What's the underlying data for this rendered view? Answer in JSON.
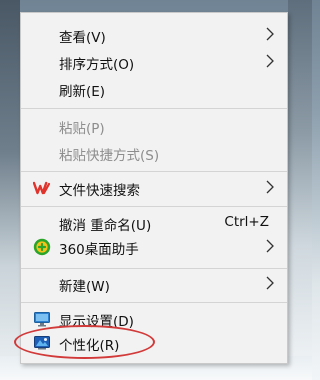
{
  "menu": {
    "items": [
      {
        "label": "查看(V)",
        "submenu": true
      },
      {
        "label": "排序方式(O)",
        "submenu": true
      },
      {
        "label": "刷新(E)"
      },
      {
        "label": "粘贴(P)",
        "disabled": true
      },
      {
        "label": "粘贴快捷方式(S)",
        "disabled": true
      },
      {
        "label": "文件快速搜索",
        "icon": "wps-icon",
        "submenu": true
      },
      {
        "label": "撤消 重命名(U)",
        "shortcut": "Ctrl+Z"
      },
      {
        "label": "360桌面助手",
        "icon": "360-desktop-assistant-icon",
        "submenu": true
      },
      {
        "label": "新建(W)",
        "submenu": true
      },
      {
        "label": "显示设置(D)",
        "icon": "display-settings-icon"
      },
      {
        "label": "个性化(R)",
        "icon": "personalize-icon"
      }
    ]
  },
  "colors": {
    "menu_bg": "#f2f2f2",
    "disabled_text": "#8d8d8d",
    "annotation_ring": "#d23a3a",
    "wps_red": "#e0332c",
    "assistant_green": "#2aa52a",
    "assistant_yellow": "#f5c21a"
  }
}
